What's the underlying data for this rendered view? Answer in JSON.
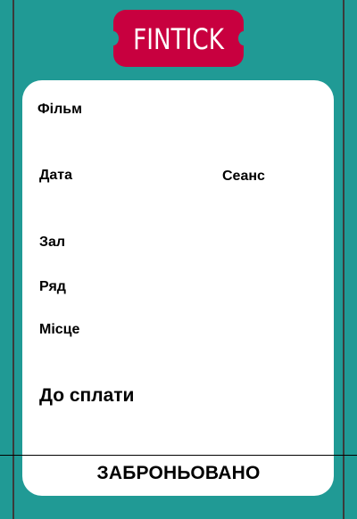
{
  "logo": {
    "text": "FINTICK"
  },
  "ticket": {
    "film_label": "Фільм",
    "date_label": "Дата",
    "session_label": "Сеанс",
    "hall_label": "Зал",
    "row_label": "Ряд",
    "seat_label": "Місце",
    "pay_label": "До сплати",
    "status": "ЗАБРОНЬОВАНО"
  },
  "colors": {
    "background": "#209a95",
    "logo_badge": "#c8003f",
    "card": "#ffffff"
  }
}
